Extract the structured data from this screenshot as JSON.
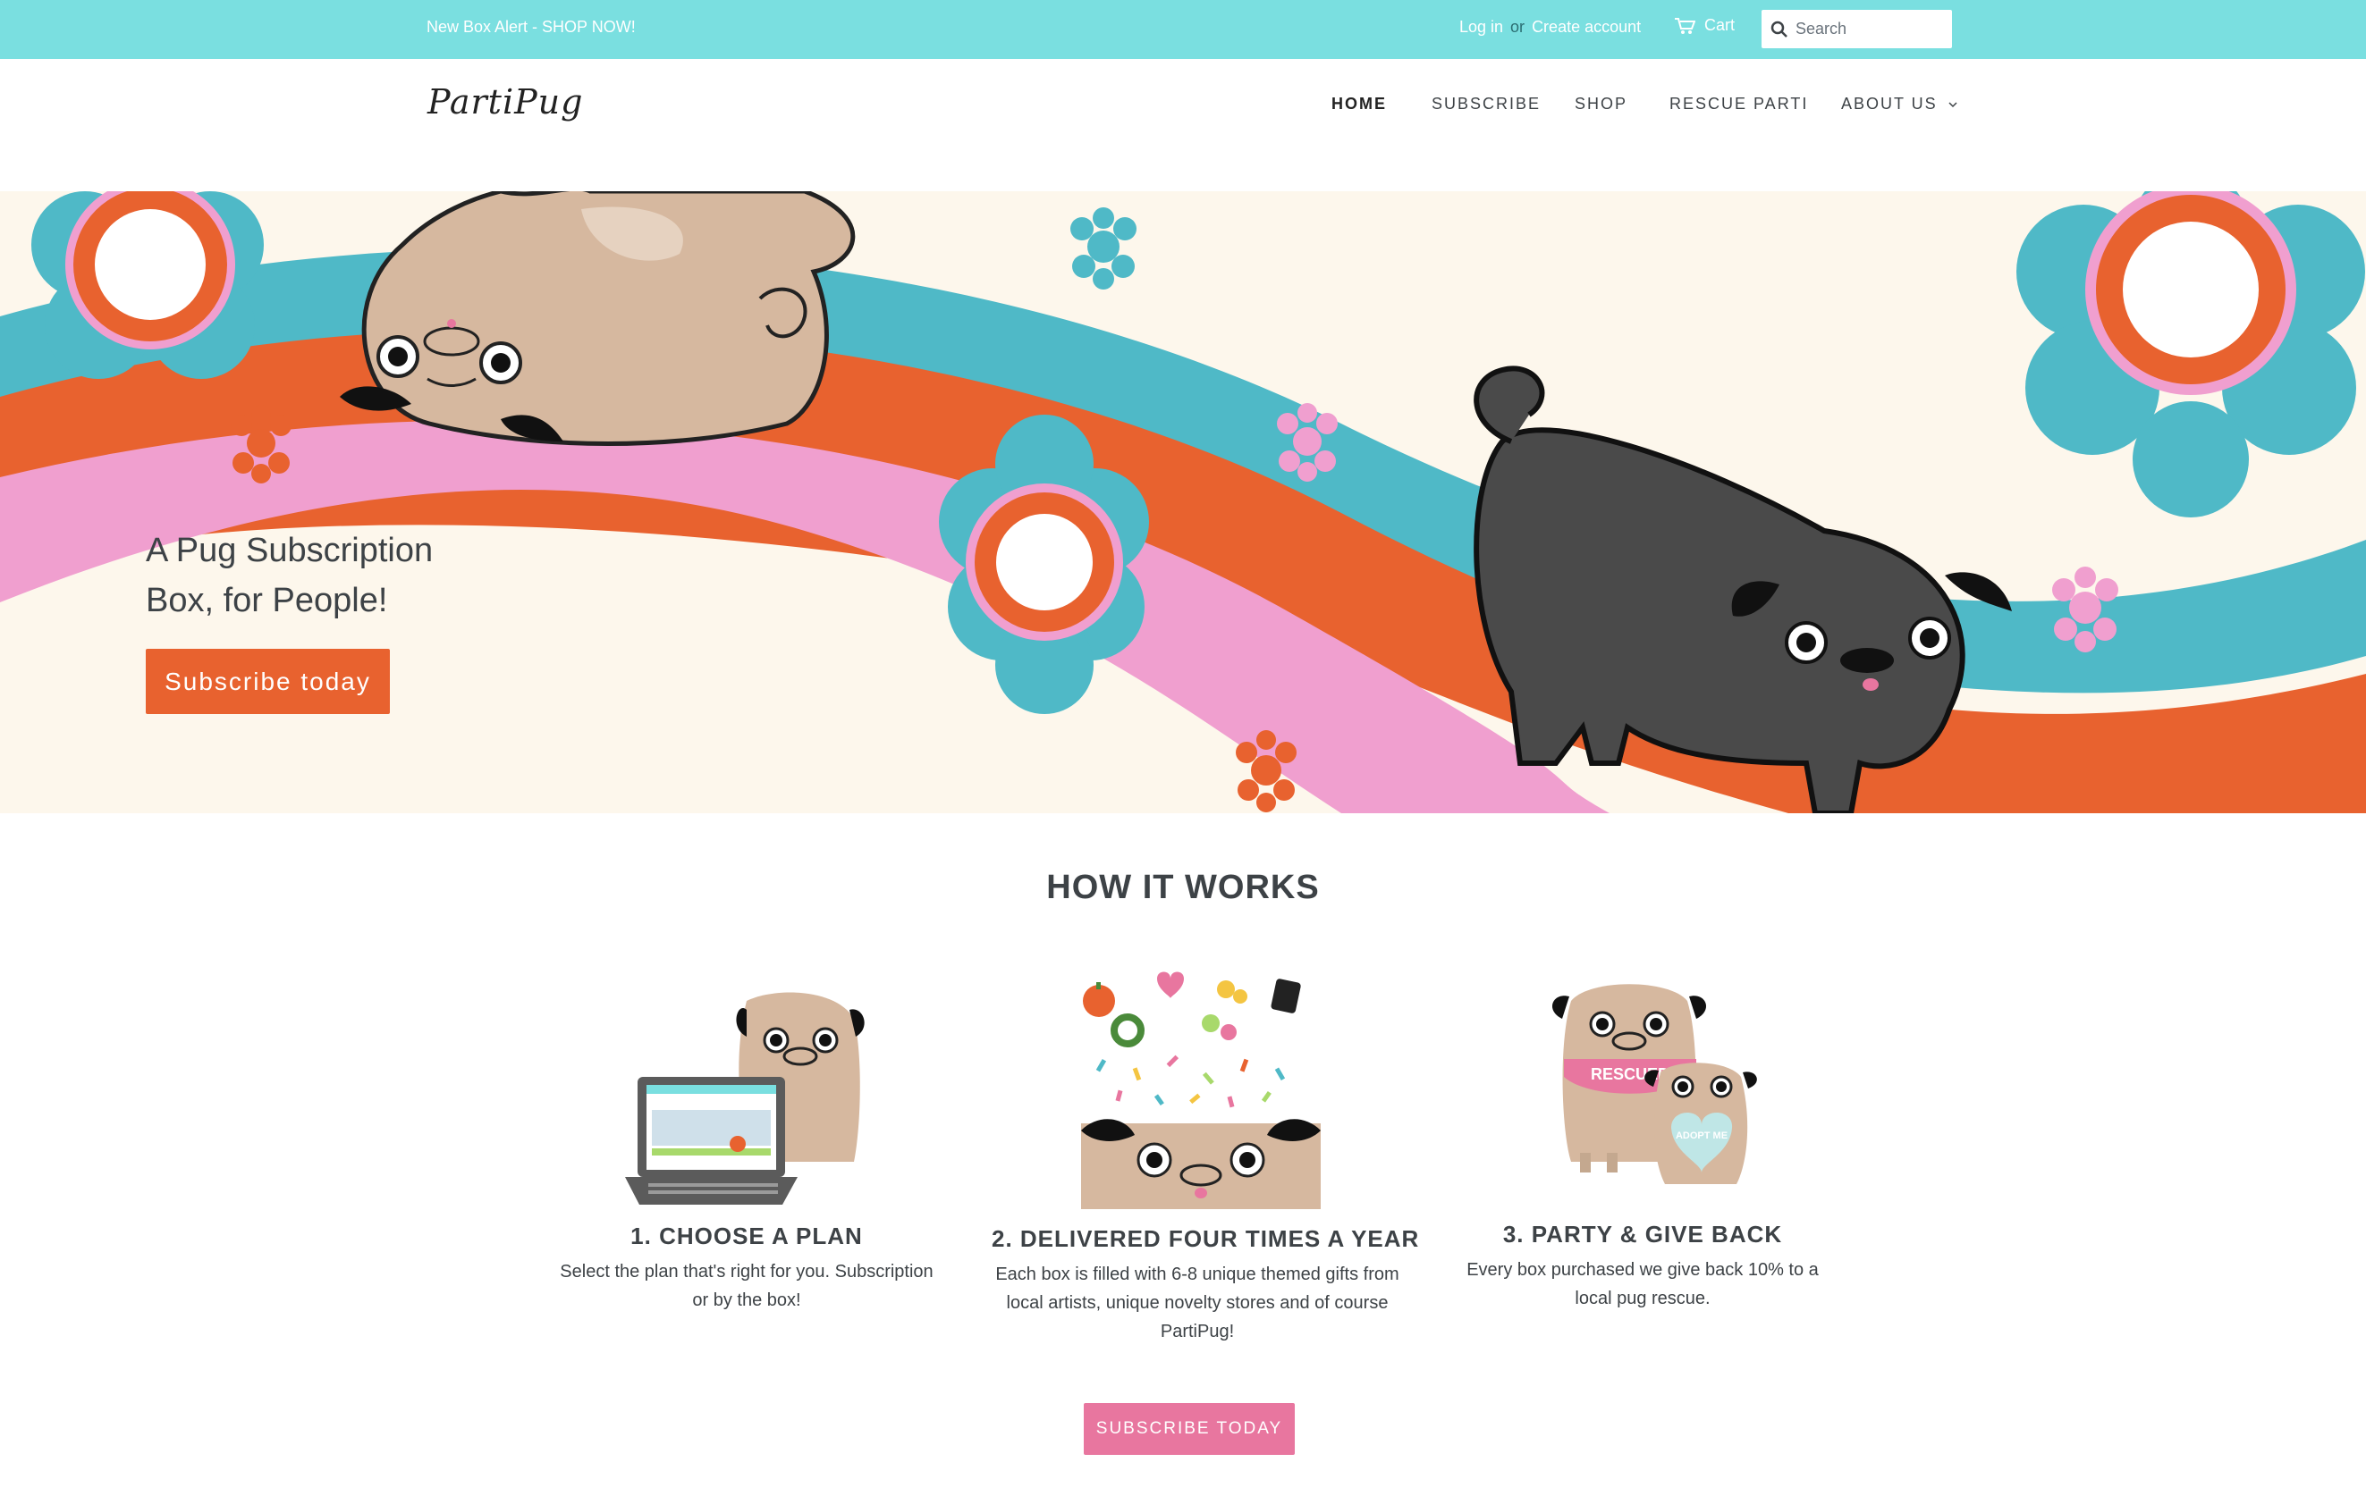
{
  "topbar": {
    "alert": "New Box Alert - SHOP NOW!",
    "login": "Log in",
    "or": "or",
    "create_account": "Create account",
    "cart": "Cart",
    "search_placeholder": "Search"
  },
  "header": {
    "logo": "PartiPug",
    "nav": [
      "HOME",
      "SUBSCRIBE",
      "SHOP",
      "RESCUE PARTI",
      "ABOUT US"
    ]
  },
  "hero": {
    "title": "A Pug Subscription Box, for People!",
    "button": "Subscribe today"
  },
  "how_it_works": {
    "title": "HOW IT WORKS",
    "steps": [
      {
        "title": "1. CHOOSE A PLAN",
        "text": "Select the plan that's right for you. Subscription or by the box!"
      },
      {
        "title": "2. DELIVERED FOUR TIMES A YEAR",
        "text": "Each box is filled with 6-8 unique themed gifts from local artists, unique novelty stores and of course PartiPug!"
      },
      {
        "title": "3. PARTY & GIVE BACK",
        "text": "Every box purchased we give back 10% to a local pug rescue.",
        "badge": "RESCUED",
        "heart": "ADOPT ME"
      }
    ],
    "cta": "SUBSCRIBE TODAY"
  },
  "colors": {
    "topbar": "#7adfe0",
    "orange": "#e8622f",
    "pink": "#e8769f",
    "teal": "#4fb9c7",
    "cream": "#fdf7ec",
    "pug_fawn": "#d6b89f",
    "pug_black": "#4a4a4a"
  },
  "icons": [
    "search-icon",
    "cart-icon",
    "chevron-down-icon"
  ]
}
